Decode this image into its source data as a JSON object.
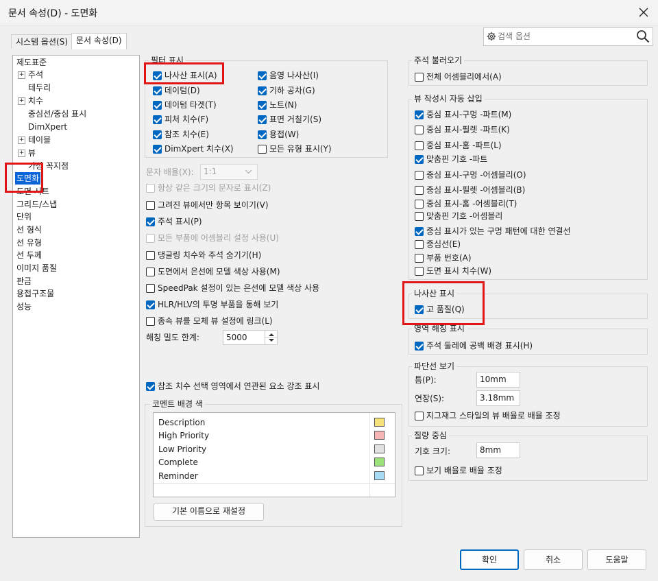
{
  "window": {
    "title": "문서 속성(D) - 도면화"
  },
  "tabs": [
    {
      "label": "시스템 옵션(S)"
    },
    {
      "label": "문서 속성(D)"
    }
  ],
  "search": {
    "placeholder": "검색 옵션"
  },
  "tree": [
    {
      "label": "제도표준"
    },
    {
      "label": "주석"
    },
    {
      "label": "테두리"
    },
    {
      "label": "치수"
    },
    {
      "label": "중심선/중심 표시"
    },
    {
      "label": "DimXpert"
    },
    {
      "label": "테이블"
    },
    {
      "label": "뷰"
    },
    {
      "label": "가상 꼭지점"
    },
    {
      "label": "도면화"
    },
    {
      "label": "도면 시트"
    },
    {
      "label": "그리드/스냅"
    },
    {
      "label": "단위"
    },
    {
      "label": "선 형식"
    },
    {
      "label": "선 유형"
    },
    {
      "label": "선 두께"
    },
    {
      "label": "이미지 품질"
    },
    {
      "label": "판금"
    },
    {
      "label": "용접구조물"
    },
    {
      "label": "성능"
    }
  ],
  "filter": {
    "title": "필터 표시",
    "items": [
      {
        "label": "나사산 표시(A)"
      },
      {
        "label": "데이텀(D)"
      },
      {
        "label": "데이텀 타겟(T)"
      },
      {
        "label": "피처 치수(F)"
      },
      {
        "label": "참조 치수(E)"
      },
      {
        "label": "DimXpert 치수(X)"
      },
      {
        "label": "음영 나사산(I)"
      },
      {
        "label": "기하 공차(G)"
      },
      {
        "label": "노트(N)"
      },
      {
        "label": "표면 거칠기(S)"
      },
      {
        "label": "용접(W)"
      },
      {
        "label": "모든 유형 표시(Y)"
      }
    ]
  },
  "text_scale": {
    "label": "문자 배율(X):",
    "value": "1:1"
  },
  "options": [
    {
      "label": "항상 같은 크기의 문자로 표시(Z)"
    },
    {
      "label": "그려진 뷰에서만 항목 보이기(V)"
    },
    {
      "label": "주석 표시(P)"
    },
    {
      "label": "모든 부품에 어셈블리 설정 사용(U)"
    },
    {
      "label": "댕글링 치수와 주석 숨기기(H)"
    },
    {
      "label": "도면에서 은선에 모델 색상 사용(M)"
    },
    {
      "label": "SpeedPak 설정이 있는 은선에 모델 색상 사용"
    },
    {
      "label": "HLR/HLV의 투명 부품을 통해 보기"
    },
    {
      "label": "종속 뷰를 모체 뷰 설정에 링크(L)"
    }
  ],
  "hatch": {
    "label": "해칭 밀도 한계:",
    "value": "5000"
  },
  "highlight": {
    "label": "참조 치수 선택 영역에서 연관된 요소 강조 표시"
  },
  "comment_bg": {
    "title": "코멘트 배경 색",
    "rows": [
      {
        "label": "Description",
        "color": "#f7e27a"
      },
      {
        "label": "High Priority",
        "color": "#f5b5b5"
      },
      {
        "label": "Low Priority",
        "color": "#e2e2e2"
      },
      {
        "label": "Complete",
        "color": "#9be27a"
      },
      {
        "label": "Reminder",
        "color": "#a8dcf5"
      }
    ],
    "reset_label": "기본 이름으로 재설정"
  },
  "ann_import": {
    "title": "주석 불러오기",
    "item": "전체 어셈블리에서(A)"
  },
  "auto_insert": {
    "title": "뷰 작성시 자동 삽입",
    "items": [
      {
        "label": "중심 표시-구멍 -파트(M)"
      },
      {
        "label": "중심 표시-필렛 -파트(K)"
      },
      {
        "label": "중심 표시-홈  -파트(L)"
      },
      {
        "label": "맞춤핀 기호 -파트"
      },
      {
        "label": "중심 표시-구멍 -어셈블리(O)"
      },
      {
        "label": "중심 표시-필렛 -어셈블리(B)"
      },
      {
        "label": "중심 표시-홈 -어셈블리(T)"
      },
      {
        "label": "맞춤핀 기호 -어셈블리"
      },
      {
        "label": "중심 표시가 있는 구멍 패턴에 대한 연결선"
      },
      {
        "label": "중심선(E)"
      },
      {
        "label": "부품 번호(A)"
      },
      {
        "label": "도면 표시 치수(W)"
      }
    ]
  },
  "thread_display": {
    "title": "나사산 표시",
    "item": "고 품질(Q)"
  },
  "area_hatch": {
    "title": "영역 해칭 표시",
    "item": "주석 둘레에 공백 배경 표시(H)"
  },
  "break_line": {
    "title": "파단선 보기",
    "gap_label": "틈(P):",
    "gap_value": "10mm",
    "ext_label": "연장(S):",
    "ext_value": "3.18mm",
    "zigzag": "지그재그 스타일의 뷰 배율로 배율 조정"
  },
  "mass_center": {
    "title": "질량 중심",
    "size_label": "기호 크기:",
    "size_value": "8mm",
    "scale": "보기 배율로 배율 조정"
  },
  "buttons": {
    "ok": "확인",
    "cancel": "취소",
    "help": "도움말"
  }
}
